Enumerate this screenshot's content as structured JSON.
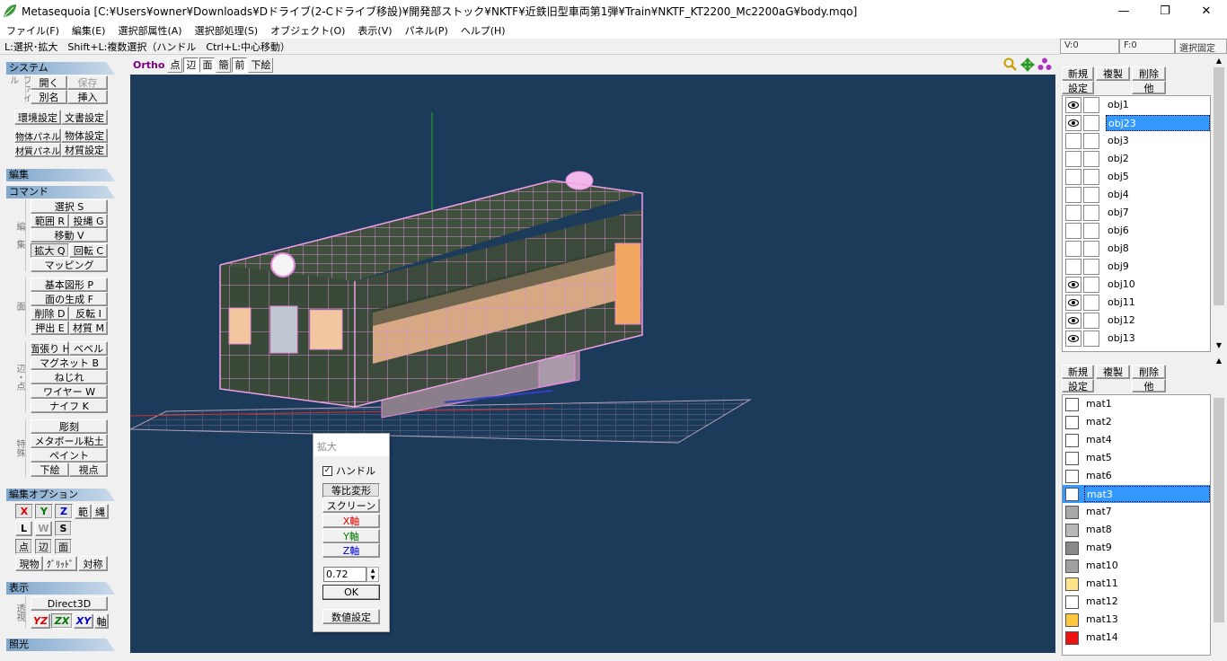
{
  "window": {
    "title": "Metasequoia [C:¥Users¥owner¥Downloads¥Dドライブ(2-Cドライブ移設)¥開発部ストック¥NKTF¥近鉄旧型車両第1弾¥Train¥NKTF_KT2200_Mc2200aG¥body.mqo]",
    "min": "—",
    "max": "❐",
    "close": "✕"
  },
  "menu": [
    "ファイル(F)",
    "編集(E)",
    "選択部属性(A)",
    "選択部処理(S)",
    "オブジェクト(O)",
    "表示(V)",
    "パネル(P)",
    "ヘルプ(H)"
  ],
  "hint": "L:選択･拡大　Shift+L:複数選択（ハンドル　Ctrl+L:中心移動）",
  "status": {
    "v": "V:0",
    "f": "F:0",
    "lock": "選択固定"
  },
  "left": {
    "system": {
      "title": "システム",
      "side": "ファイル",
      "open": "開く",
      "save": "保存",
      "rename": "別名",
      "insert": "挿入",
      "env": "環境設定",
      "doc": "文書設定",
      "objpanel": "物体パネル",
      "objset": "物体設定",
      "matpanel": "材質パネル",
      "matset": "材質設定"
    },
    "edit": {
      "title": "編集"
    },
    "command": {
      "title": "コマンド",
      "side1": "編　集",
      "select": "選択 S",
      "range": "範囲 R",
      "lasso": "投縄 G",
      "move": "移動 V",
      "scale": "拡大 Q",
      "rotate": "回転 C",
      "mapping": "マッピング",
      "side2": "面",
      "primitive": "基本図形 P",
      "facegen": "面の生成 F",
      "delete": "削除 D",
      "flip": "反転 I",
      "extrude": "押出 E",
      "material": "材質 M",
      "side3": "辺・点",
      "stretch": "面張り H",
      "bevel": "ベベル",
      "magnet": "マグネット B",
      "twist": "ねじれ",
      "wire": "ワイヤー W",
      "knife": "ナイフ K",
      "side4": "特殊",
      "sculpt": "彫刻",
      "metaball": "メタボール粘土",
      "paint": "ペイント",
      "underlay": "下絵",
      "view": "視点"
    },
    "editopt": {
      "title": "編集オプション",
      "x": "X",
      "y": "Y",
      "z": "Z",
      "range": "範",
      "lasso": "縄",
      "l": "L",
      "w": "W",
      "s": "S",
      "pt": "点",
      "edge": "辺",
      "face": "面",
      "curobj": "現物",
      "grid": "ｸﾞﾘｯﾄﾞ",
      "sym": "対称"
    },
    "display": {
      "title": "表示",
      "side": "透視",
      "d3d": "Direct3D",
      "yz": "YZ",
      "zx": "ZX",
      "xy": "XY",
      "axis": "軸"
    },
    "light": {
      "title": "照光"
    }
  },
  "viewport": {
    "toolbar": [
      "点",
      "辺",
      "面",
      "簡",
      "前",
      "下絵"
    ],
    "ortho": "Ortho"
  },
  "objects": {
    "buttons": {
      "new": "新規",
      "copy": "複製",
      "delete": "削除",
      "settings": "設定",
      "other": "他"
    },
    "items": [
      {
        "name": "obj1",
        "vis": true
      },
      {
        "name": "obj23",
        "vis": true,
        "sel": true
      },
      {
        "name": "obj3",
        "vis": false
      },
      {
        "name": "obj2",
        "vis": false
      },
      {
        "name": "obj5",
        "vis": false
      },
      {
        "name": "obj4",
        "vis": false
      },
      {
        "name": "obj7",
        "vis": false
      },
      {
        "name": "obj6",
        "vis": false
      },
      {
        "name": "obj8",
        "vis": false
      },
      {
        "name": "obj9",
        "vis": false
      },
      {
        "name": "obj10",
        "vis": true
      },
      {
        "name": "obj11",
        "vis": true
      },
      {
        "name": "obj12",
        "vis": true
      },
      {
        "name": "obj13",
        "vis": true
      }
    ]
  },
  "materials": {
    "buttons": {
      "new": "新規",
      "copy": "複製",
      "delete": "削除",
      "settings": "設定",
      "other": "他"
    },
    "items": [
      {
        "name": "mat1",
        "color": "#ffffff"
      },
      {
        "name": "mat2",
        "color": "#ffffff"
      },
      {
        "name": "mat4",
        "color": "#ffffff"
      },
      {
        "name": "mat5",
        "color": "#ffffff"
      },
      {
        "name": "mat6",
        "color": "#ffffff"
      },
      {
        "name": "mat3",
        "color": "#ffffff",
        "sel": true
      },
      {
        "name": "mat7",
        "color": "#a8a8a8"
      },
      {
        "name": "mat8",
        "color": "#b8b8b8"
      },
      {
        "name": "mat9",
        "color": "#888888"
      },
      {
        "name": "mat10",
        "color": "#a0a0a0"
      },
      {
        "name": "mat11",
        "color": "#ffe38a"
      },
      {
        "name": "mat12",
        "color": "#ffffff"
      },
      {
        "name": "mat13",
        "color": "#ffc83c"
      },
      {
        "name": "mat14",
        "color": "#ee1111"
      }
    ]
  },
  "dialog": {
    "title": "拡大",
    "handle": "ハンドル",
    "uniform": "等比変形",
    "screen": "スクリーン",
    "xaxis": "X軸",
    "yaxis": "Y軸",
    "zaxis": "Z軸",
    "value": "0.72",
    "ok": "OK",
    "numeric": "数値設定"
  }
}
